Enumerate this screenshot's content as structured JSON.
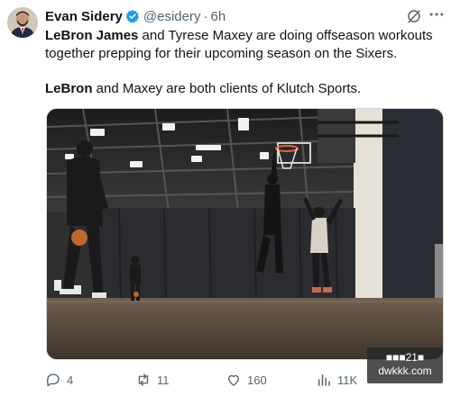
{
  "author": {
    "name": "Evan Sidery",
    "handle": "@esidery",
    "separator": "·",
    "time": "6h"
  },
  "tweet": {
    "p1_bold1": "LeBron James",
    "p1_text1": " and Tyrese Maxey are doing offseason workouts together prepping for their upcoming season on the Sixers.",
    "p2_bold": "LeBron",
    "p2_text": " and Maxey are both clients of Klutch Sports."
  },
  "actions": {
    "replies": "4",
    "reposts": "11",
    "likes": "160",
    "views": "11K"
  },
  "watermark": {
    "line1": "■■■21■",
    "line2": "dwkkk.com"
  },
  "colors": {
    "verified": "#1d9bf0",
    "muted": "#536471",
    "text": "#0f1419"
  },
  "icons": [
    "verified-badge-icon",
    "grok-icon",
    "more-icon",
    "reply-icon",
    "repost-icon",
    "like-icon",
    "views-icon",
    "bookmark-icon",
    "share-icon"
  ]
}
